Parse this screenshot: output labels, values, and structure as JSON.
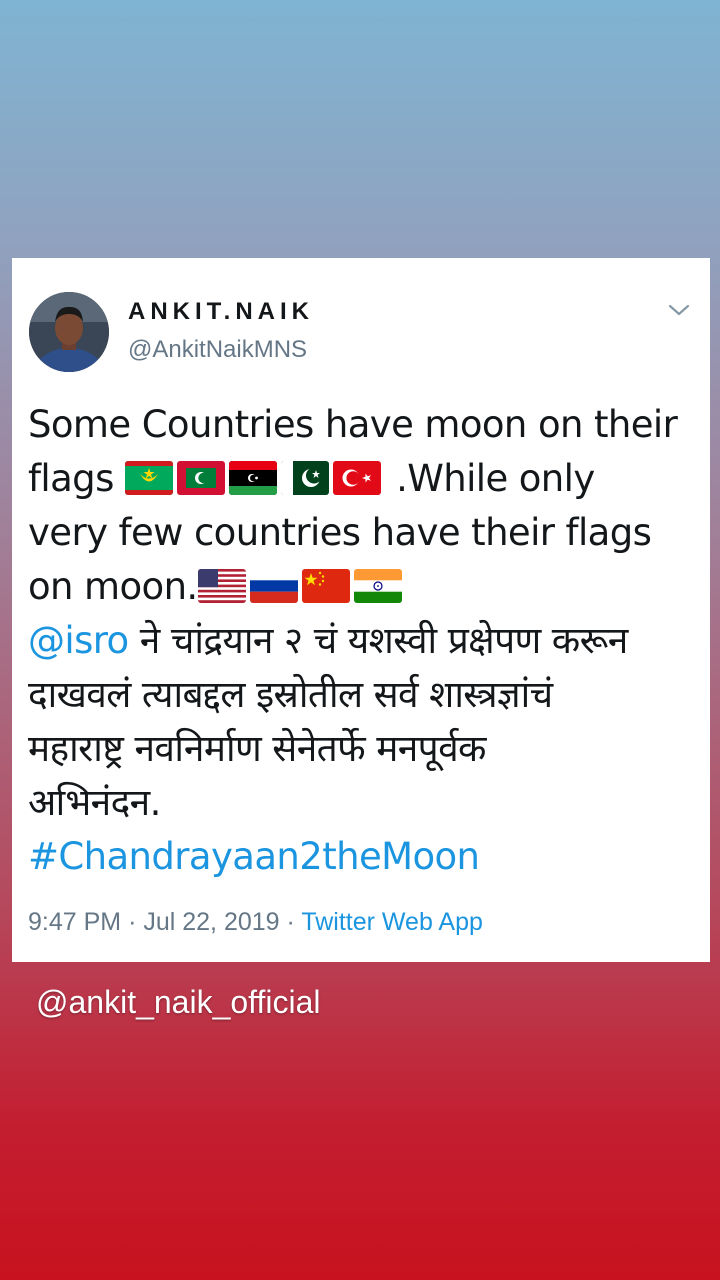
{
  "tweet": {
    "display_name": "ANKIT.NAIK",
    "handle": "@AnkitNaikMNS",
    "menu_icon": "chevron-down-icon",
    "text": {
      "line1": "Some Countries have moon on their",
      "line2_prefix": "flags",
      "line2_suffix": " .While only",
      "line3": "very few countries have their flags",
      "line4_prefix": "on moon.",
      "mention": "@isro",
      "line5_suffix": " ने चांद्रयान २ चं यशस्वी प्रक्षेपण करून",
      "line6": "दाखवलं त्याबद्दल इस्रोतील सर्व शास्त्रज्ञांचं",
      "line7": "महाराष्ट्र नवनिर्माण सेनेतर्फे मनपूर्वक",
      "line8": "अभिनंदन.",
      "hashtag": "#Chandrayaan2theMoon"
    },
    "moon_flags": [
      "mauritania-flag-icon",
      "maldives-flag-icon",
      "libya-flag-icon",
      "pakistan-flag-icon",
      "turkey-flag-icon"
    ],
    "landing_flags": [
      "usa-flag-icon",
      "russia-flag-icon",
      "china-flag-icon",
      "india-flag-icon"
    ],
    "time": "9:47 PM",
    "separator": "·",
    "date": "Jul 22, 2019",
    "source_app": "Twitter Web App"
  },
  "watermark": "@ankit_naik_official",
  "colors": {
    "link": "#1b95e0",
    "text": "#14171a",
    "muted": "#657786"
  }
}
